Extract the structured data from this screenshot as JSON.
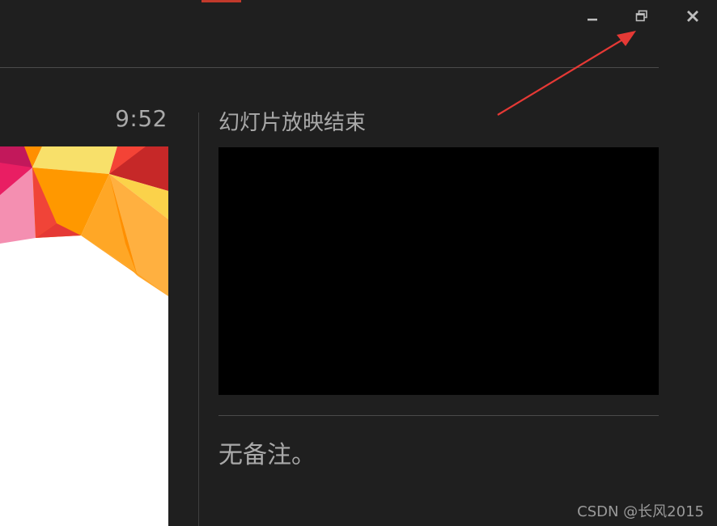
{
  "window": {
    "controls": {
      "minimize_icon": "minimize-icon",
      "restore_icon": "restore-icon",
      "close_icon": "close-icon"
    },
    "accent_color": "#c1392b"
  },
  "presenter": {
    "timer": "9:52",
    "next_slide_title": "幻灯片放映结束",
    "notes": "无备注。"
  },
  "annotation": {
    "arrow_color": "#e53935"
  },
  "watermark": "CSDN @长风2015"
}
